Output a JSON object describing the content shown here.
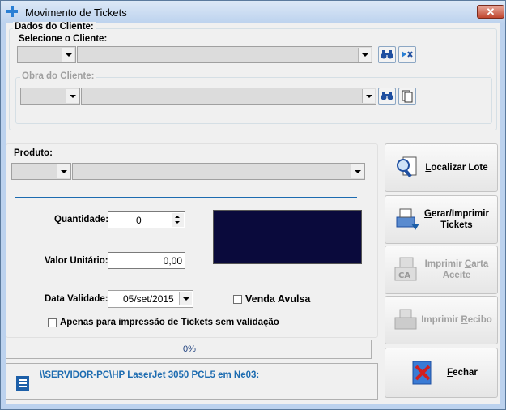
{
  "window": {
    "title": "Movimento de Tickets",
    "close_label": "✕"
  },
  "cliente": {
    "group_title": "Dados do Cliente:",
    "select_label": "Selecione o Cliente:",
    "obra_label": "Obra do Cliente:"
  },
  "produto": {
    "label": "Produto:"
  },
  "quantidade": {
    "label": "Quantidade:",
    "value": "0"
  },
  "valor_unitario": {
    "label": "Valor Unitário:",
    "value": "0,00"
  },
  "data_validade": {
    "label": "Data Validade:",
    "value": "05/set/2015"
  },
  "venda_avulsa": {
    "label": "Venda Avulsa",
    "checked": false
  },
  "apenas_impressao": {
    "label": "Apenas para impressão de Tickets sem validação",
    "checked": false
  },
  "progress": {
    "text": "0%",
    "value": 0
  },
  "status": {
    "printer": "\\\\SERVIDOR-PC\\HP LaserJet 3050 PCL5 em Ne03:"
  },
  "buttons": {
    "localizar_lote": {
      "prefix": "L",
      "rest": "ocalizar Lote"
    },
    "gerar_imprimir": {
      "prefix": "G",
      "rest": "erar/Imprimir",
      "line2": "Tickets"
    },
    "imprimir_carta": {
      "line1a": "Imprimir ",
      "line1b": "C",
      "line1c": "arta",
      "line2": "Aceite"
    },
    "imprimir_recibo": {
      "a": "Imprimir ",
      "b": "R",
      "c": "ecibo"
    },
    "fechar": {
      "prefix": "F",
      "rest": "echar"
    }
  },
  "colors": {
    "display_bg": "#0a0a3c",
    "accent_line": "#1c6bb0",
    "status_text": "#1c6bb0"
  }
}
